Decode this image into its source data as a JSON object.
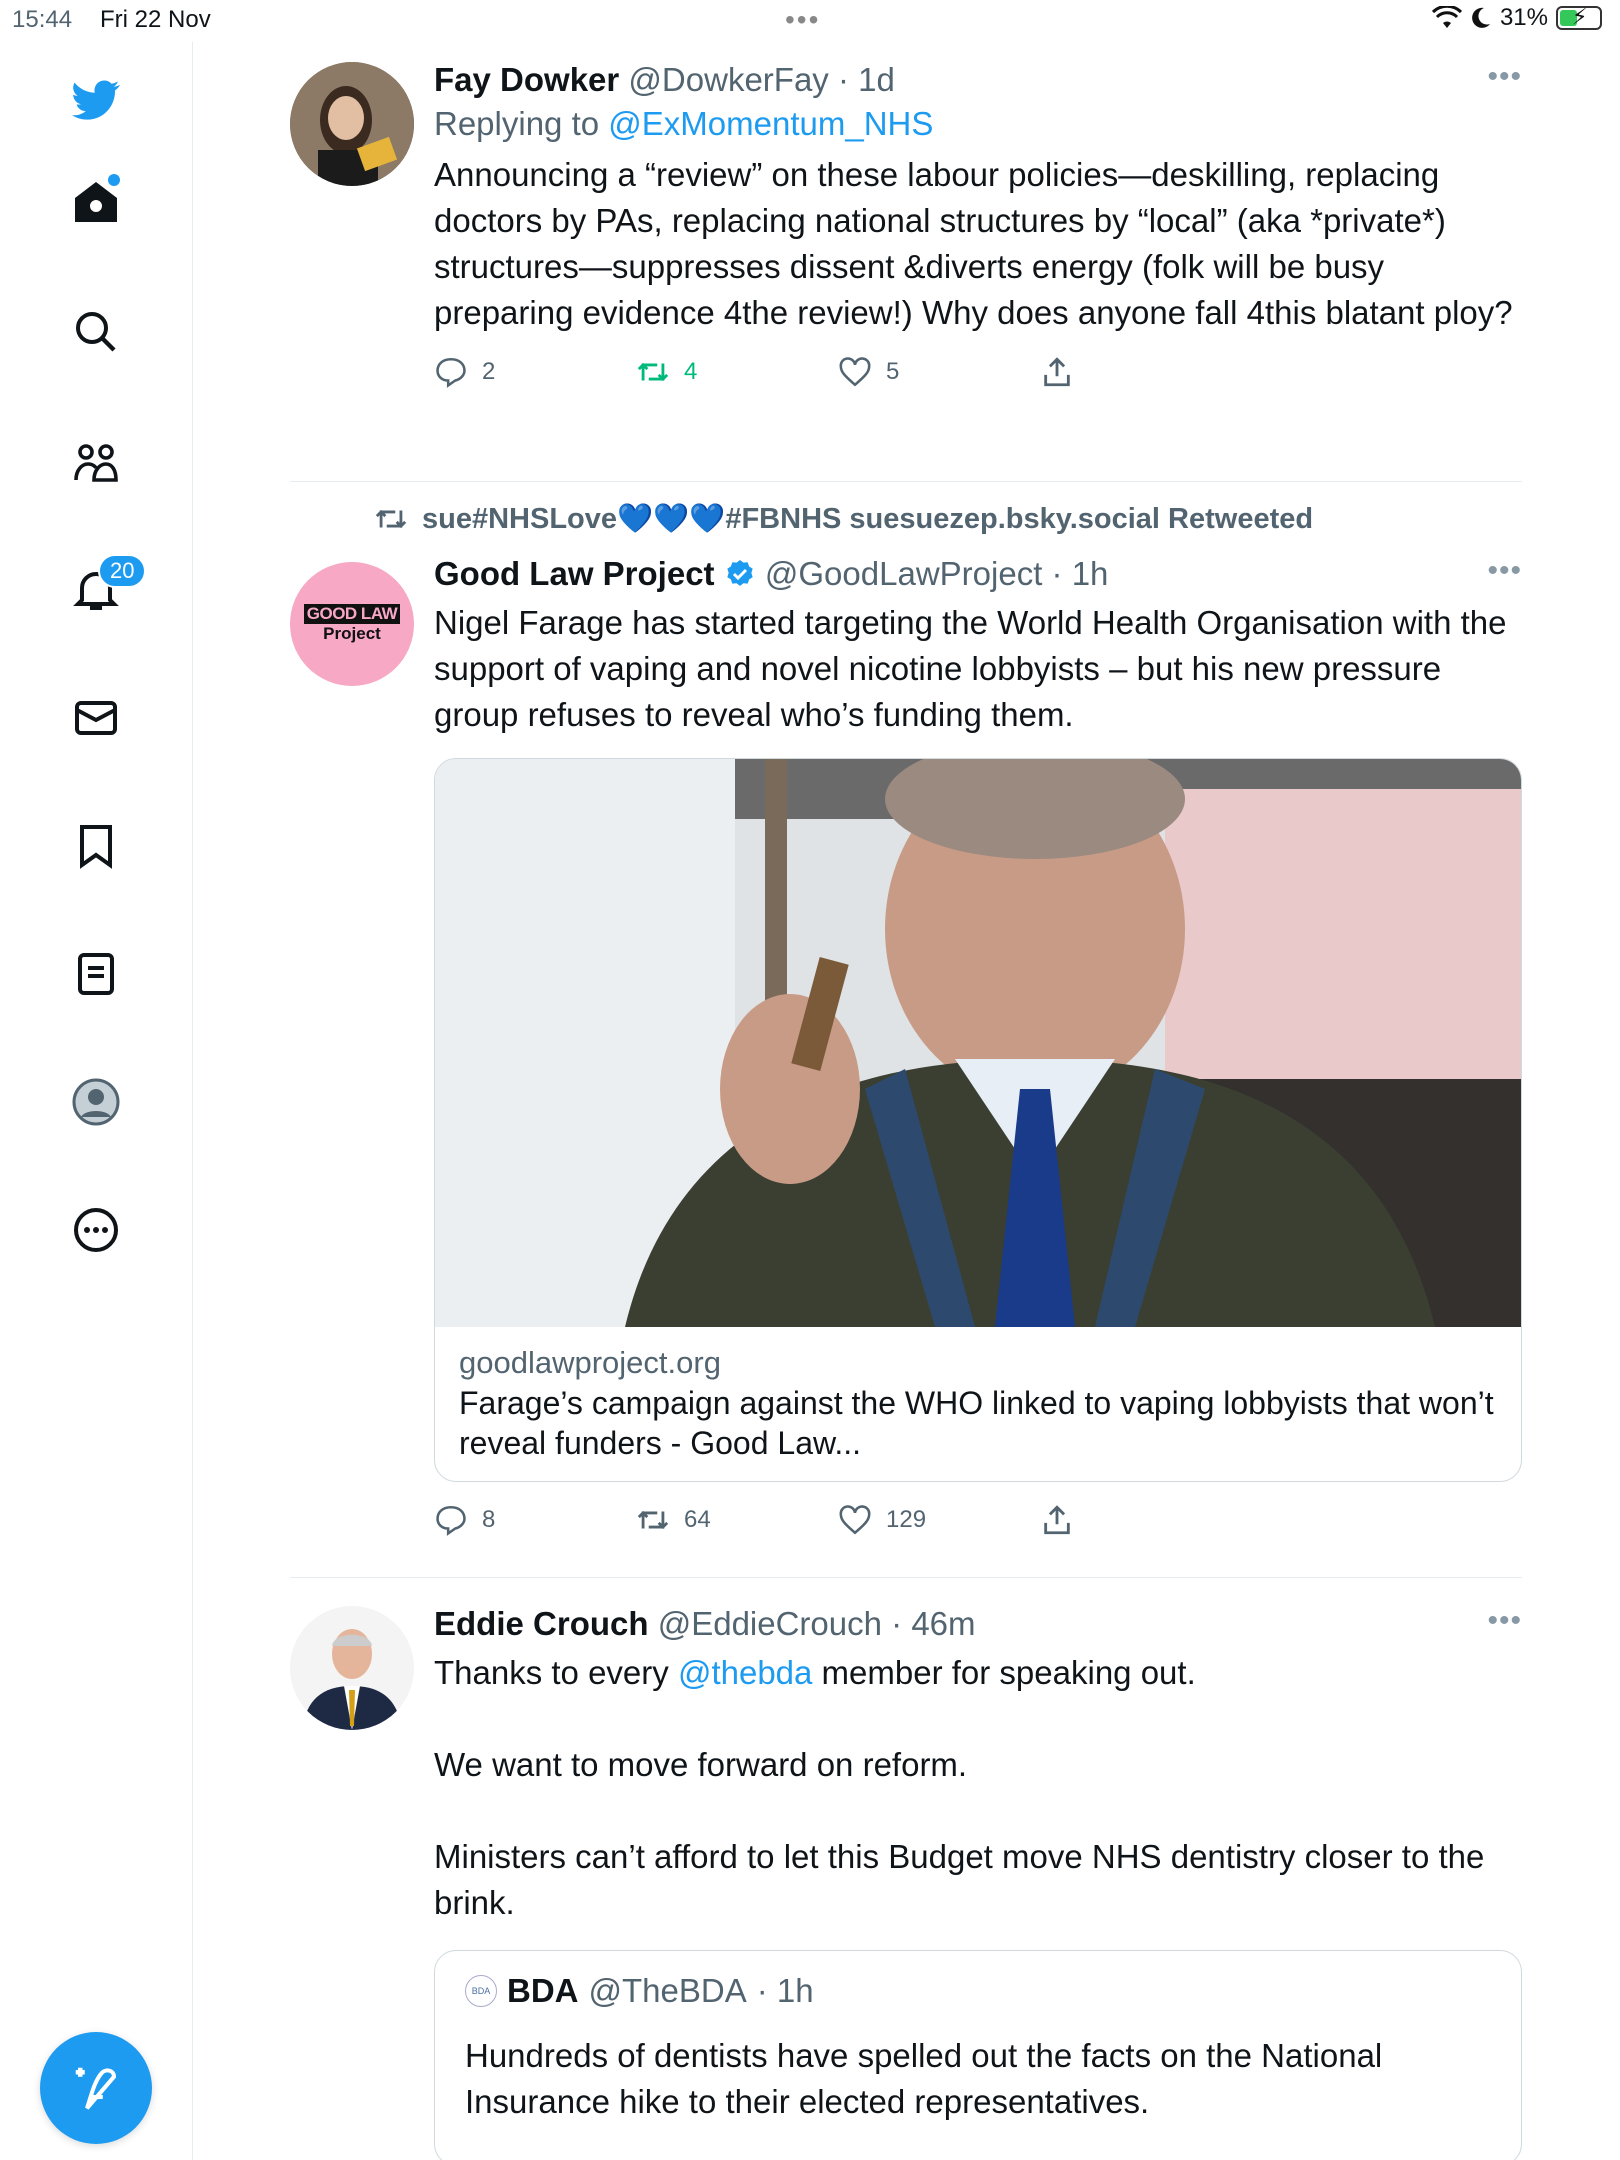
{
  "status_bar": {
    "time": "15:44",
    "date": "Fri 22 Nov",
    "battery": "31%"
  },
  "sidebar": {
    "notification_count": "20"
  },
  "tweets": [
    {
      "name": "Fay Dowker",
      "handle": "@DowkerFay",
      "time": "· 1d",
      "replying_label": "Replying to",
      "replying_to": "@ExMomentum_NHS",
      "text": "Announcing a “review” on these labour policies—deskilling, replacing doctors by PAs, replacing national structures by “local” (aka *private*) structures—suppresses dissent &diverts energy (folk will be busy preparing evidence 4the review!) Why does anyone fall 4this blatant ploy?",
      "replies": "2",
      "retweets": "4",
      "likes": "5"
    },
    {
      "social_context": "sue#NHSLove💙💙💙#FBNHS suesuezep.bsky.social Retweeted",
      "name": "Good Law Project",
      "handle": "@GoodLawProject",
      "time": "· 1h",
      "avatar_text_1": "GOOD LAW",
      "avatar_text_2": "Project",
      "text": "Nigel Farage has started targeting the World Health Organisation with the support of vaping and novel nicotine lobbyists – but his new pressure group refuses to reveal who’s funding them.",
      "card_domain": "goodlawproject.org",
      "card_title": "Farage’s campaign against the WHO linked to vaping lobbyists that won’t reveal funders - Good Law...",
      "replies": "8",
      "retweets": "64",
      "likes": "129"
    },
    {
      "name": "Eddie Crouch",
      "handle": "@EddieCrouch",
      "time": "· 46m",
      "text_a": "Thanks to every ",
      "mention": "@thebda",
      "text_b": " member for speaking out.",
      "text_2": "We want to move forward on reform.",
      "text_3": "Ministers can’t afford to let this Budget move NHS dentistry closer to the brink.",
      "quote": {
        "avatar_text": "BDA",
        "name": "BDA",
        "handle": "@TheBDA",
        "time": "· 1h",
        "text": "Hundreds of dentists have spelled out the facts on the National Insurance hike to their elected representatives."
      }
    }
  ],
  "colors": {
    "accent": "#1d9bf0",
    "retweet": "#00ba7c",
    "muted": "#536471"
  }
}
